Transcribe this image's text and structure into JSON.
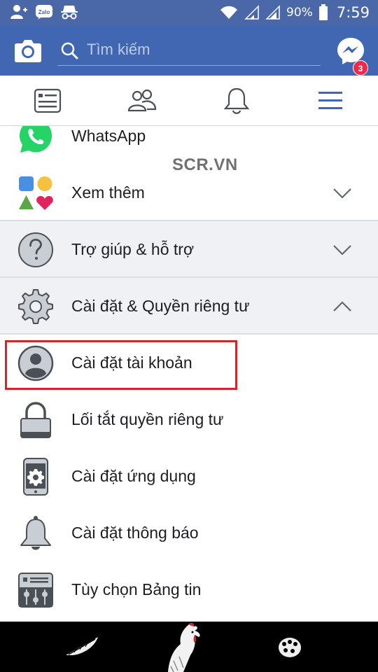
{
  "status_bar": {
    "battery_percent": "90%",
    "time": "7:59",
    "notification_icons": [
      "add-friend-icon",
      "zalo-icon",
      "incognito-icon"
    ]
  },
  "top_bar": {
    "search_placeholder": "Tìm kiếm",
    "messenger_badge": "3"
  },
  "nav_tabs": [
    "news-feed-icon",
    "friends-icon",
    "notifications-icon",
    "menu-icon"
  ],
  "watermark": "SCR.VN",
  "menu_items": [
    {
      "label": "WhatsApp",
      "icon": "whatsapp-icon"
    },
    {
      "label": "Xem thêm",
      "icon": "see-more-icon",
      "chevron": "down"
    },
    {
      "label": "Trợ giúp & hỗ trợ",
      "icon": "help-icon",
      "chevron": "down"
    },
    {
      "label": "Cài đặt & Quyền riêng tư",
      "icon": "gear-icon",
      "chevron": "up"
    },
    {
      "label": "Cài đặt tài khoản",
      "icon": "account-icon",
      "highlighted": true
    },
    {
      "label": "Lối tắt quyền riêng tư",
      "icon": "lock-icon"
    },
    {
      "label": "Cài đặt ứng dụng",
      "icon": "phone-settings-icon"
    },
    {
      "label": "Cài đặt thông báo",
      "icon": "bell-icon"
    },
    {
      "label": "Tùy chọn Bảng tin",
      "icon": "news-feed-preferences-icon"
    }
  ],
  "colors": {
    "brand_blue": "#4267b2",
    "highlight_red": "#d3262b",
    "whatsapp_green": "#25d366"
  }
}
